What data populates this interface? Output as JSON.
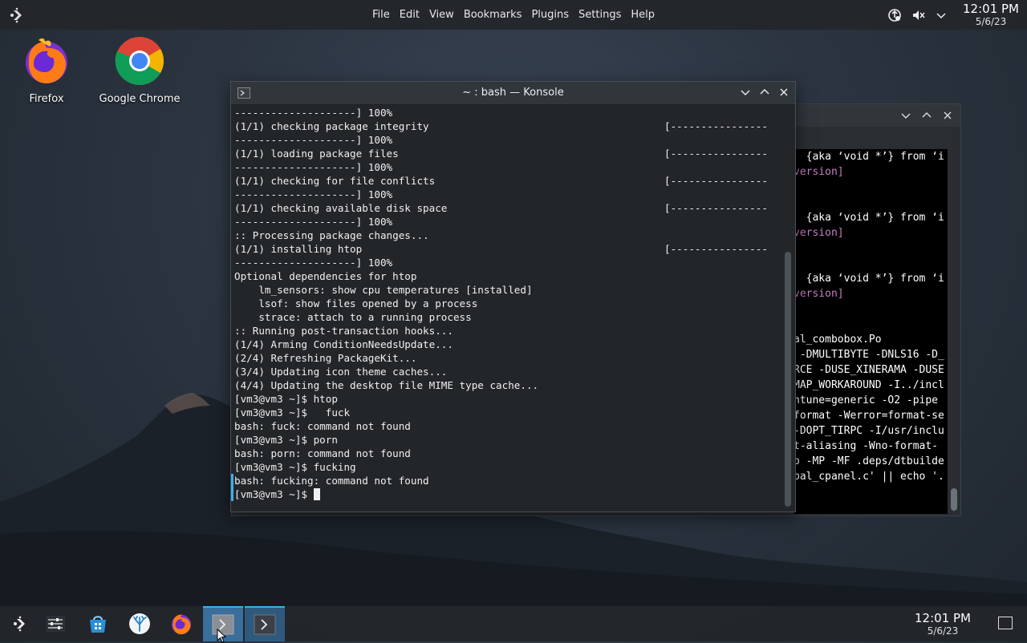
{
  "top_panel": {
    "menu": [
      "File",
      "Edit",
      "View",
      "Bookmarks",
      "Plugins",
      "Settings",
      "Help"
    ],
    "clock": {
      "time": "12:01 PM",
      "date": "5/6/23"
    }
  },
  "desktop_icons": [
    {
      "label": "Firefox",
      "icon": "firefox-icon"
    },
    {
      "label": "Google Chrome",
      "icon": "chrome-icon"
    }
  ],
  "konsole": {
    "title": "~ : bash — Konsole",
    "lines": [
      {
        "text": "--------------------] 100%"
      },
      {
        "text": "(1/1) checking package integrity",
        "bar": "[----------------"
      },
      {
        "text": "--------------------] 100%"
      },
      {
        "text": "(1/1) loading package files",
        "bar": "[----------------"
      },
      {
        "text": "--------------------] 100%"
      },
      {
        "text": "(1/1) checking for file conflicts",
        "bar": "[----------------"
      },
      {
        "text": "--------------------] 100%"
      },
      {
        "text": "(1/1) checking available disk space",
        "bar": "[----------------"
      },
      {
        "text": "--------------------] 100%"
      },
      {
        "text": ":: Processing package changes..."
      },
      {
        "text": "(1/1) installing htop",
        "bar": "[----------------"
      },
      {
        "text": "--------------------] 100%"
      },
      {
        "text": "Optional dependencies for htop"
      },
      {
        "text": "    lm_sensors: show cpu temperatures [installed]"
      },
      {
        "text": "    lsof: show files opened by a process"
      },
      {
        "text": "    strace: attach to a running process"
      },
      {
        "text": ":: Running post-transaction hooks..."
      },
      {
        "text": "(1/4) Arming ConditionNeedsUpdate..."
      },
      {
        "text": "(2/4) Refreshing PackageKit..."
      },
      {
        "text": "(3/4) Updating icon theme caches..."
      },
      {
        "text": "(4/4) Updating the desktop file MIME type cache..."
      },
      {
        "text": "[vm3@vm3 ~]$ htop"
      },
      {
        "text": "[vm3@vm3 ~]$   fuck"
      },
      {
        "text": "bash: fuck: command not found"
      },
      {
        "text": "[vm3@vm3 ~]$ porn"
      },
      {
        "text": "bash: porn: command not found"
      },
      {
        "text": "[vm3@vm3 ~]$ fucking"
      },
      {
        "text": "bash: fucking: command not found"
      }
    ],
    "prompt": "[vm3@vm3 ~]$ "
  },
  "back_window": {
    "lines": [
      {
        "a": "",
        "b": "  {aka ‘void *’} from ‘i"
      },
      {
        "a": "version]",
        "b": "",
        "purple": true
      },
      {
        "a": "",
        "b": ""
      },
      {
        "a": "",
        "b": ""
      },
      {
        "a": "",
        "b": "  {aka ‘void *’} from ‘i"
      },
      {
        "a": "version]",
        "b": "",
        "purple": true
      },
      {
        "a": "",
        "b": ""
      },
      {
        "a": "",
        "b": ""
      },
      {
        "a": "",
        "b": "  {aka ‘void *’} from ‘i"
      },
      {
        "a": "version]",
        "b": "",
        "purple": true
      },
      {
        "a": "",
        "b": ""
      },
      {
        "a": "",
        "b": ""
      },
      {
        "a": "al_combobox.Po",
        "b": ""
      },
      {
        "a": " -DMULTIBYTE -DNLS16 -D_",
        "b": ""
      },
      {
        "a": "RCE -DUSE_XINERAMA -DUSE",
        "b": ""
      },
      {
        "a": "MAP_WORKAROUND -I../incl",
        "b": ""
      },
      {
        "a": "ntune=generic -O2 -pipe ",
        "b": ""
      },
      {
        "a": "format -Werror=format-se",
        "b": ""
      },
      {
        "a": "-DOPT_TIRPC -I/usr/inclu",
        "b": ""
      },
      {
        "a": "t-aliasing -Wno-format-",
        "b": ""
      },
      {
        "a": "o -MP -MF .deps/dtbuilde",
        "b": ""
      },
      {
        "a": "bal_cpanel.c' || echo '.",
        "b": ""
      }
    ]
  },
  "taskbar": {
    "items": [
      "app-launcher",
      "system-settings",
      "discover-store",
      "plasma-icon",
      "firefox",
      "konsole-1",
      "konsole-2"
    ],
    "clock": {
      "time": "12:01 PM",
      "date": "5/6/23"
    }
  }
}
